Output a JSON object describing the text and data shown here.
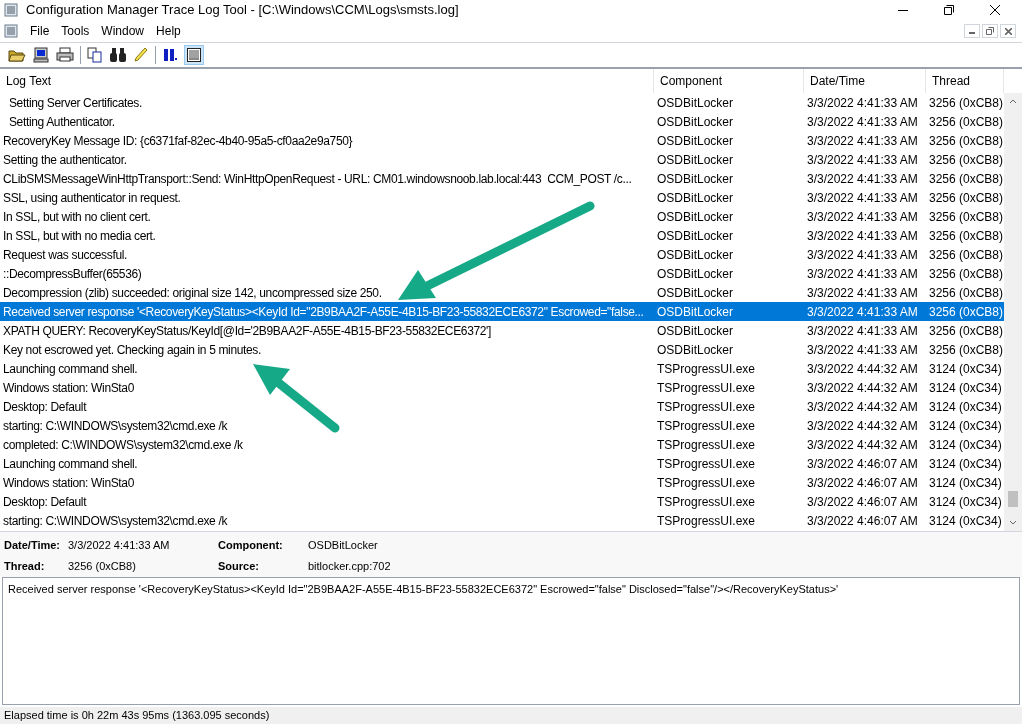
{
  "window": {
    "title": "Configuration Manager Trace Log Tool - [C:\\Windows\\CCM\\Logs\\smsts.log]"
  },
  "menu": [
    "File",
    "Tools",
    "Window",
    "Help"
  ],
  "table": {
    "columns": [
      "Log Text",
      "Component",
      "Date/Time",
      "Thread"
    ],
    "rows": [
      {
        "text": "  Setting Server Certificates.",
        "component": "OSDBitLocker",
        "datetime": "3/3/2022 4:41:33 AM",
        "thread": "3256 (0xCB8)",
        "selected": false
      },
      {
        "text": "  Setting Authenticator.",
        "component": "OSDBitLocker",
        "datetime": "3/3/2022 4:41:33 AM",
        "thread": "3256 (0xCB8)",
        "selected": false
      },
      {
        "text": "RecoveryKey Message ID: {c6371faf-82ec-4b40-95a5-cf0aa2e9a750}",
        "component": "OSDBitLocker",
        "datetime": "3/3/2022 4:41:33 AM",
        "thread": "3256 (0xCB8)",
        "selected": false
      },
      {
        "text": "Setting the authenticator.",
        "component": "OSDBitLocker",
        "datetime": "3/3/2022 4:41:33 AM",
        "thread": "3256 (0xCB8)",
        "selected": false
      },
      {
        "text": "CLibSMSMessageWinHttpTransport::Send: WinHttpOpenRequest - URL: CM01.windowsnoob.lab.local:443  CCM_POST /c...",
        "component": "OSDBitLocker",
        "datetime": "3/3/2022 4:41:33 AM",
        "thread": "3256 (0xCB8)",
        "selected": false
      },
      {
        "text": "SSL, using authenticator in request.",
        "component": "OSDBitLocker",
        "datetime": "3/3/2022 4:41:33 AM",
        "thread": "3256 (0xCB8)",
        "selected": false
      },
      {
        "text": "In SSL, but with no client cert.",
        "component": "OSDBitLocker",
        "datetime": "3/3/2022 4:41:33 AM",
        "thread": "3256 (0xCB8)",
        "selected": false
      },
      {
        "text": "In SSL, but with no media cert.",
        "component": "OSDBitLocker",
        "datetime": "3/3/2022 4:41:33 AM",
        "thread": "3256 (0xCB8)",
        "selected": false
      },
      {
        "text": "Request was successful.",
        "component": "OSDBitLocker",
        "datetime": "3/3/2022 4:41:33 AM",
        "thread": "3256 (0xCB8)",
        "selected": false
      },
      {
        "text": "::DecompressBuffer(65536)",
        "component": "OSDBitLocker",
        "datetime": "3/3/2022 4:41:33 AM",
        "thread": "3256 (0xCB8)",
        "selected": false
      },
      {
        "text": "Decompression (zlib) succeeded: original size 142, uncompressed size 250.",
        "component": "OSDBitLocker",
        "datetime": "3/3/2022 4:41:33 AM",
        "thread": "3256 (0xCB8)",
        "selected": false
      },
      {
        "text": "Received server response '<RecoveryKeyStatus><KeyId Id=\"2B9BAA2F-A55E-4B15-BF23-55832ECE6372\" Escrowed=\"false...",
        "component": "OSDBitLocker",
        "datetime": "3/3/2022 4:41:33 AM",
        "thread": "3256 (0xCB8)",
        "selected": true
      },
      {
        "text": "XPATH QUERY: RecoveryKeyStatus/KeyId[@Id='2B9BAA2F-A55E-4B15-BF23-55832ECE6372']",
        "component": "OSDBitLocker",
        "datetime": "3/3/2022 4:41:33 AM",
        "thread": "3256 (0xCB8)",
        "selected": false
      },
      {
        "text": "Key not escrowed yet. Checking again in 5 minutes.",
        "component": "OSDBitLocker",
        "datetime": "3/3/2022 4:41:33 AM",
        "thread": "3256 (0xCB8)",
        "selected": false
      },
      {
        "text": "Launching command shell.",
        "component": "TSProgressUI.exe",
        "datetime": "3/3/2022 4:44:32 AM",
        "thread": "3124 (0xC34)",
        "selected": false
      },
      {
        "text": "Windows station: WinSta0",
        "component": "TSProgressUI.exe",
        "datetime": "3/3/2022 4:44:32 AM",
        "thread": "3124 (0xC34)",
        "selected": false
      },
      {
        "text": "Desktop: Default",
        "component": "TSProgressUI.exe",
        "datetime": "3/3/2022 4:44:32 AM",
        "thread": "3124 (0xC34)",
        "selected": false
      },
      {
        "text": "starting: C:\\WINDOWS\\system32\\cmd.exe /k",
        "component": "TSProgressUI.exe",
        "datetime": "3/3/2022 4:44:32 AM",
        "thread": "3124 (0xC34)",
        "selected": false
      },
      {
        "text": "completed: C:\\WINDOWS\\system32\\cmd.exe /k",
        "component": "TSProgressUI.exe",
        "datetime": "3/3/2022 4:44:32 AM",
        "thread": "3124 (0xC34)",
        "selected": false
      },
      {
        "text": "Launching command shell.",
        "component": "TSProgressUI.exe",
        "datetime": "3/3/2022 4:46:07 AM",
        "thread": "3124 (0xC34)",
        "selected": false
      },
      {
        "text": "Windows station: WinSta0",
        "component": "TSProgressUI.exe",
        "datetime": "3/3/2022 4:46:07 AM",
        "thread": "3124 (0xC34)",
        "selected": false
      },
      {
        "text": "Desktop: Default",
        "component": "TSProgressUI.exe",
        "datetime": "3/3/2022 4:46:07 AM",
        "thread": "3124 (0xC34)",
        "selected": false
      },
      {
        "text": "starting: C:\\WINDOWS\\system32\\cmd.exe /k",
        "component": "TSProgressUI.exe",
        "datetime": "3/3/2022 4:46:07 AM",
        "thread": "3124 (0xC34)",
        "selected": false
      }
    ]
  },
  "details": {
    "fields": [
      {
        "label": "Date/Time:",
        "value": "3/3/2022 4:41:33 AM"
      },
      {
        "label": "Component:",
        "value": "OSDBitLocker"
      },
      {
        "label": "Thread:",
        "value": "3256 (0xCB8)"
      },
      {
        "label": "Source:",
        "value": "bitlocker.cpp:702"
      }
    ],
    "message": "Received server response '<RecoveryKeyStatus><KeyId Id=\"2B9BAA2F-A55E-4B15-BF23-55832ECE6372\" Escrowed=\"false\" Disclosed=\"false\"/></RecoveryKeyStatus>'"
  },
  "status_bar": "Elapsed time is 0h 22m 43s 95ms (1363.095 seconds)"
}
